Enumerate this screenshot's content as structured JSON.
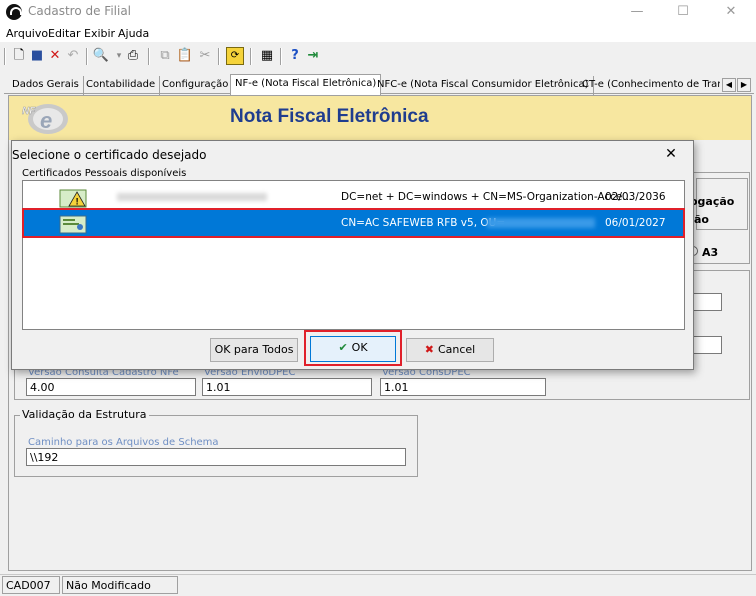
{
  "window": {
    "title": "Cadastro de Filial",
    "minimize": "—",
    "maximize": "☐",
    "close": "✕"
  },
  "menu": [
    "Arquivo",
    "Editar",
    "Exibir",
    "Ajuda"
  ],
  "toolbar": {
    "icons": [
      "new-icon",
      "save-icon",
      "delete-icon",
      "undo-icon",
      "preview-icon",
      "print-icon",
      "copy-icon",
      "paste-icon",
      "cut-icon",
      "refresh-icon",
      "calculator-icon",
      "help-icon",
      "exit-icon"
    ]
  },
  "tabs": [
    {
      "label": "Dados Gerais"
    },
    {
      "label": "Contabilidade"
    },
    {
      "label": "Configuração"
    },
    {
      "label": "NF-e (Nota Fiscal Eletrônica)"
    },
    {
      "label": "NFC-e (Nota Fiscal Consumidor Eletrônica)"
    },
    {
      "label": "CT-e (Conhecimento de Tran:"
    }
  ],
  "tab_scroll": {
    "left": "◀",
    "right": "▶"
  },
  "banner": {
    "title": "Nota Fiscal Eletrônica",
    "logo_text": "NF e"
  },
  "form": {
    "behind_text_1": "ogação",
    "behind_text_2": "ão",
    "radio_label": "A3",
    "versions": {
      "consulta_label": "Versão Consulta Cadastro NFe",
      "consulta_value": "4.00",
      "envio_label": "Versão EnvioDPEC",
      "envio_value": "1.01",
      "consulta_dpec_label": "Versão ConsDPEC",
      "consulta_dpec_value": "1.01"
    },
    "validacao": {
      "legend": "Validação da Estrutura",
      "schema_label": "Caminho para os Arquivos de Schema",
      "schema_value": "\\\\192"
    }
  },
  "dialog": {
    "title": "Selecione o certificado desejado",
    "close": "✕",
    "list_label": "Certificados Pessoais disponíveis",
    "certificates": [
      {
        "subject": "DC=net + DC=windows + CN=MS-Organization-Acce...",
        "expires": "02/03/2036",
        "selected": false,
        "warning": true
      },
      {
        "subject": "CN=AC SAFEWEB RFB v5, OU=",
        "expires": "06/01/2027",
        "selected": true,
        "warning": false
      }
    ],
    "buttons": {
      "ok_todos": "OK para Todos",
      "ok": "OK",
      "cancel": "Cancel"
    }
  },
  "status": {
    "code": "CAD007",
    "state": "Não Modificado"
  },
  "colors": {
    "selection": "#0078d7",
    "highlight_border": "#e0202a",
    "banner_bg": "#f7e7a0",
    "banner_text": "#1f3d8f"
  }
}
